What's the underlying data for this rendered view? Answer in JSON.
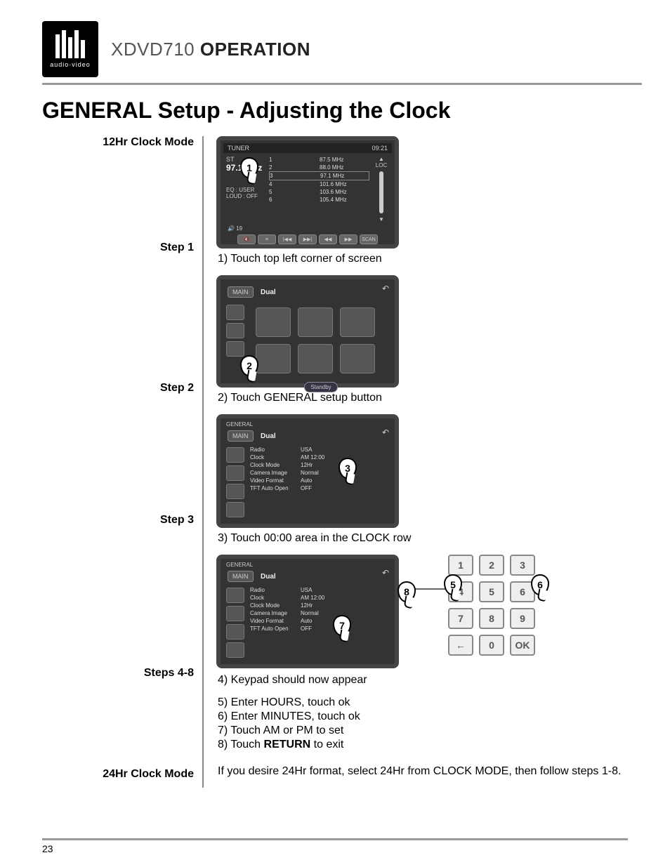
{
  "brand_sub": "audio·video",
  "header_model": "XDVD710",
  "header_word": "OPERATION",
  "page_title": "GENERAL Setup - Adjusting the Clock",
  "labels": {
    "mode12": "12Hr Clock Mode",
    "step1": "Step 1",
    "step2": "Step 2",
    "step3": "Step 3",
    "steps48": "Steps 4-8",
    "mode24": "24Hr Clock Mode"
  },
  "captions": {
    "c1": "1) Touch top left corner of screen",
    "c2": "2) Touch GENERAL setup button",
    "c3": "3) Touch 00:00 area in the CLOCK row",
    "c4": "4) Keypad should now appear",
    "c5": "5) Enter HOURS, touch ok",
    "c6": "6) Enter MINUTES, touch ok",
    "c7": "7) Touch AM or PM to set",
    "c8a": "8) Touch ",
    "c8b": "RETURN",
    "c8c": " to exit",
    "c24": "If you desire 24Hr format, select 24Hr from CLOCK MODE, then follow steps 1-8."
  },
  "bubbles": {
    "b1": "1",
    "b2": "2",
    "b3": "3",
    "b5": "5",
    "b6": "6",
    "b7": "7",
    "b8": "8"
  },
  "shot1": {
    "title_left": "TUNER",
    "time": "09:21",
    "freq": "97.1 MHz",
    "st": "ST",
    "loc": "LOC",
    "presets": [
      [
        "1",
        "87.5 MHz"
      ],
      [
        "2",
        "88.0 MHz"
      ],
      [
        "3",
        "97.1 MHz"
      ],
      [
        "4",
        "101.6 MHz"
      ],
      [
        "5",
        "103.6 MHz"
      ],
      [
        "6",
        "105.4 MHz"
      ]
    ],
    "eq": "EQ   : USER",
    "loud": "LOUD : OFF",
    "vol": "19",
    "scan": "SCAN"
  },
  "shot2": {
    "main": "MAIN",
    "brand": "Dual",
    "standby": "Standby"
  },
  "shot3": {
    "title": "GENERAL",
    "main": "MAIN",
    "brand": "Dual",
    "rows": [
      [
        "Radio",
        "USA"
      ],
      [
        "Clock",
        "AM 12:00"
      ],
      [
        "Clock Mode",
        "12Hr"
      ],
      [
        "Camera Image",
        "Normal"
      ],
      [
        "Video Format",
        "Auto"
      ],
      [
        "TFT Auto Open",
        "OFF"
      ]
    ]
  },
  "shot4": {
    "title": "GENERAL",
    "main": "MAIN",
    "brand": "Dual",
    "rows": [
      [
        "Radio",
        "USA"
      ],
      [
        "Clock",
        "AM 12:00"
      ],
      [
        "Clock Mode",
        "12Hr"
      ],
      [
        "Camera Image",
        "Normal"
      ],
      [
        "Video Format",
        "Auto"
      ],
      [
        "TFT Auto Open",
        "OFF"
      ]
    ]
  },
  "keypad": [
    "1",
    "2",
    "3",
    "4",
    "5",
    "6",
    "7",
    "8",
    "9",
    "←",
    "0",
    "OK"
  ],
  "page_number": "23"
}
